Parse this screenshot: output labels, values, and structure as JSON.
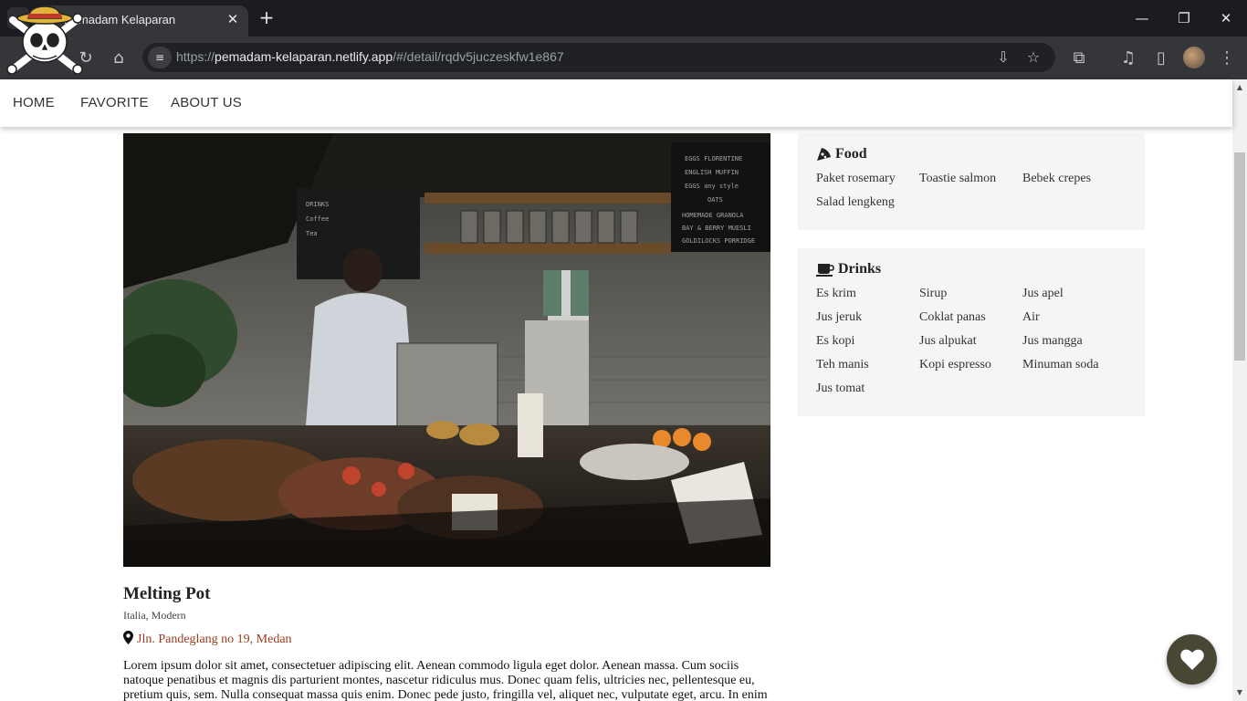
{
  "browser": {
    "tab_title": "Pemadam Kelaparan",
    "url_scheme": "https://",
    "url_host": "pemadam-kelaparan.netlify.app",
    "url_path": "/#/detail/rqdv5juczeskfw1e867"
  },
  "nav": {
    "home": "HOME",
    "favorite": "FAVORITE",
    "about": "ABOUT US"
  },
  "restaurant": {
    "name": "Melting Pot",
    "categories": "Italia, Modern",
    "address": "Jln. Pandeglang no 19, Medan",
    "description": "Lorem ipsum dolor sit amet, consectetuer adipiscing elit. Aenean commodo ligula eget dolor. Aenean massa. Cum sociis natoque penatibus et magnis dis parturient montes, nascetur ridiculus mus. Donec quam felis, ultricies nec, pellentesque eu, pretium quis, sem. Nulla consequat massa quis enim. Donec pede justo, fringilla vel, aliquet nec, vulputate eget, arcu. In enim"
  },
  "menus": {
    "food": {
      "title": "Food",
      "items": [
        "Paket rosemary",
        "Toastie salmon",
        "Bebek crepes",
        "Salad lengkeng"
      ]
    },
    "drinks": {
      "title": "Drinks",
      "items": [
        "Es krim",
        "Sirup",
        "Jus apel",
        "Jus jeruk",
        "Coklat panas",
        "Air",
        "Es kopi",
        "Jus alpukat",
        "Jus mangga",
        "Teh manis",
        "Kopi espresso",
        "Minuman soda",
        "Jus tomat"
      ]
    }
  },
  "colors": {
    "accent": "#9b3b1f",
    "fab": "#4a4634",
    "menu_bg": "#f5f5f5"
  }
}
